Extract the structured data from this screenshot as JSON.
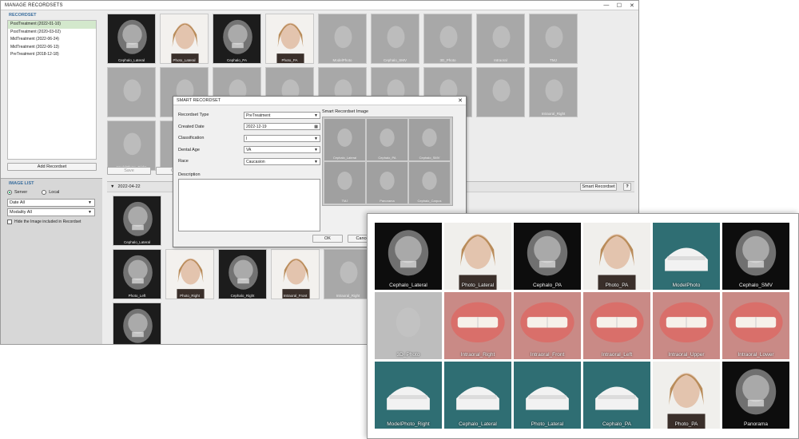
{
  "window": {
    "title": "MANAGE RECORDSETS",
    "minimize": "—",
    "maximize": "☐",
    "close": "✕"
  },
  "recordset": {
    "heading": "RECORDSET",
    "items": [
      "PostTreatment (2022-01-10)",
      "PostTreatment (2020-03-02)",
      "MidTreatment (2022-06-24)",
      "MidTreatment (2022-06-13)",
      "PreTreatment (2018-12-18)"
    ],
    "selected_index": 0,
    "add_button": "Add Recordset"
  },
  "image_list": {
    "heading": "IMAGE LIST",
    "source_options": [
      "Server",
      "Local"
    ],
    "source_selected": "Server",
    "date_filter": "Date All",
    "modality_filter": "Modality All",
    "hide_checkbox_label": "Hide the Image included in Recordset"
  },
  "top_tiles": [
    {
      "label": "Cephalo_Lateral",
      "kind": "xray"
    },
    {
      "label": "Photo_Lateral",
      "kind": "photo"
    },
    {
      "label": "Cephalo_PA",
      "kind": "xray"
    },
    {
      "label": "Photo_PA",
      "kind": "photo"
    },
    {
      "label": "ModelPhoto",
      "kind": "gray"
    },
    {
      "label": "Cephalo_SMV",
      "kind": "gray"
    },
    {
      "label": "3D_Photo",
      "kind": "gray"
    },
    {
      "label": "Intraoral",
      "kind": "gray"
    },
    {
      "label": "TMJ",
      "kind": "gray"
    },
    {
      "label": "",
      "kind": "gray"
    },
    {
      "label": "Photo_Left",
      "kind": "gray"
    },
    {
      "label": "",
      "kind": "gray"
    },
    {
      "label": "",
      "kind": "gray"
    },
    {
      "label": "",
      "kind": "gray"
    },
    {
      "label": "",
      "kind": "gray"
    },
    {
      "label": "",
      "kind": "gray"
    },
    {
      "label": "",
      "kind": "gray"
    },
    {
      "label": "Intraoral_Right",
      "kind": "gray"
    },
    {
      "label": "ModelPhoto_Right",
      "kind": "gray"
    },
    {
      "label": "",
      "kind": "gray"
    }
  ],
  "save_bar": {
    "save": "Save",
    "cancel": "Cancel"
  },
  "date_group": {
    "date": "2022-04-22",
    "smart_button": "Smart Recordset",
    "help": "?"
  },
  "group_tiles": [
    {
      "label": "Cephalo_Lateral",
      "kind": "xray"
    },
    {
      "label": "Photo_Left",
      "kind": "xray"
    },
    {
      "label": "Photo_Right",
      "kind": "photo"
    },
    {
      "label": "Cephalo_Right",
      "kind": "xray"
    },
    {
      "label": "Intraoral_Front",
      "kind": "photo"
    },
    {
      "label": "Intraoral_Right",
      "kind": "gray"
    },
    {
      "label": "",
      "kind": "xray"
    }
  ],
  "dialog": {
    "title": "SMART RECORDSET",
    "close": "✕",
    "fields": [
      {
        "label": "Recordset Type",
        "value": "PreTreatment",
        "type": "select"
      },
      {
        "label": "Created Date",
        "value": "2022-12-19",
        "type": "date"
      },
      {
        "label": "Classification",
        "value": "I",
        "type": "select"
      },
      {
        "label": "Dental Age",
        "value": "VA",
        "type": "select"
      },
      {
        "label": "Race",
        "value": "Caucasion",
        "type": "select"
      }
    ],
    "description_label": "Description",
    "smart_image_heading": "Smart Recordset Image",
    "smart_tiles": [
      "Cephalo_Lateral",
      "Cephalo_PA",
      "Cephalo_SMV",
      "TMJ",
      "Panorama",
      "Cephalo_Carpus"
    ],
    "ok": "OK",
    "cancel": "Cancel"
  },
  "overlay_tiles": [
    {
      "label": "Cephalo_Lateral",
      "kind": "oxray"
    },
    {
      "label": "Photo_Lateral",
      "kind": "ophoto"
    },
    {
      "label": "Cephalo_PA",
      "kind": "oxray"
    },
    {
      "label": "Photo_PA",
      "kind": "ophoto"
    },
    {
      "label": "ModelPhoto",
      "kind": "teal"
    },
    {
      "label": "Cephalo_SMV",
      "kind": "oxray"
    },
    {
      "label": "3D_Photo",
      "kind": "gray"
    },
    {
      "label": "Intraoral_Right",
      "kind": "gum"
    },
    {
      "label": "Intraoral_Front",
      "kind": "gum"
    },
    {
      "label": "Intraoral_Left",
      "kind": "gum"
    },
    {
      "label": "Intraoral_Upper",
      "kind": "gum"
    },
    {
      "label": "Intraoral_Lower",
      "kind": "gum"
    },
    {
      "label": "ModelPhoto_Right",
      "kind": "teal"
    },
    {
      "label": "Cephalo_Lateral",
      "kind": "teal"
    },
    {
      "label": "Photo_Lateral",
      "kind": "teal"
    },
    {
      "label": "Cephalo_PA",
      "kind": "teal"
    },
    {
      "label": "Photo_PA",
      "kind": "ophoto"
    },
    {
      "label": "Panorama",
      "kind": "oxray"
    }
  ],
  "colors": {
    "accent": "#3a6e9e",
    "selected_row": "#d3e8cc",
    "teal": "#2f6e73",
    "gum": "#c98a86"
  }
}
